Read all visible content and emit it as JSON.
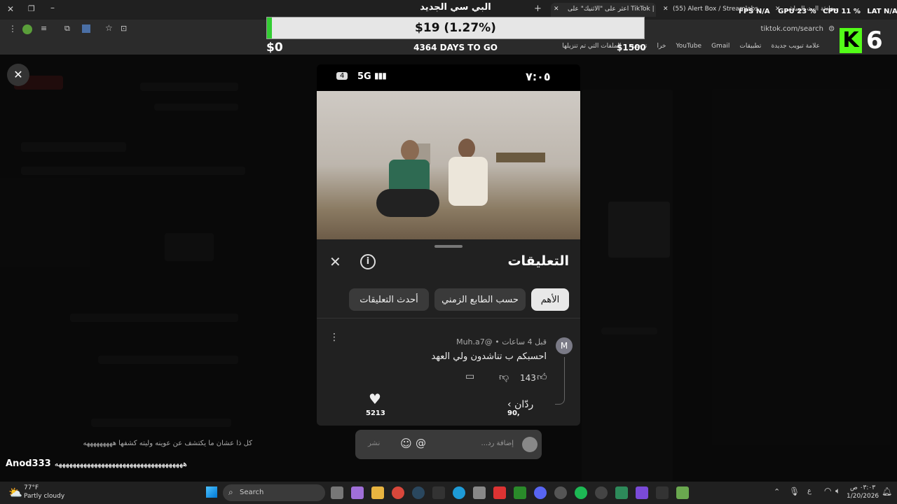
{
  "browser": {
    "tabs": [
      {
        "label": "اعثر على \"الاثنيك\" على TikTok | يـ"
      },
      {
        "label": "(55) Alert Box / Streamlabs"
      },
      {
        "label": "محادثة البث المباشر"
      }
    ],
    "stream_title": "البي سي الجديد",
    "url": "tiktok.com/search",
    "bookmarks": [
      "علامة تبويب جديدة",
      "تطبيقات",
      "Gmail",
      "YouTube",
      "خرا",
      "ترجمة",
      "الملفات التي تم تنزيلها"
    ]
  },
  "stream_overlay": {
    "goal_text": "$19 (1.27%)",
    "goal_progress_fraction": 0.0127,
    "goal_min": "$0",
    "goal_max": "$1500",
    "countdown": "4364 DAYS TO GO",
    "fps_label": "FPS",
    "fps_value": "N/A",
    "gpu_label": "GPU",
    "gpu_value": "23 %",
    "cpu_label": "CPU",
    "cpu_value": "11 %",
    "lat_label": "LAT",
    "lat_value": "N/A",
    "badge_number": "6",
    "chat_user": "Anod333",
    "chat_message": "ههههههههههههههههههههههههههههههههههههه",
    "chat_line_above": "كل ذا عشان ما يكتشف عن عوينه وليته كشفها هههههههههه"
  },
  "phone": {
    "carrier_badge": "4",
    "network": "5G",
    "time": "٧:٠٥"
  },
  "comments_panel": {
    "title": "التعليقات",
    "tabs": [
      {
        "label": "الأهم",
        "active": true
      },
      {
        "label": "حسب الطابع الزمني",
        "active": false
      },
      {
        "label": "أحدث التعليقات",
        "active": false
      }
    ],
    "comment": {
      "avatar_letter": "M",
      "author": "@Muh.a7",
      "separator": "•",
      "time": "قبل 4 ساعات",
      "text": "احسبكم ب تناشدون ولي العهد",
      "likes": "143",
      "replies_label": "ردّان",
      "reply_count_badge": "90,"
    },
    "video_likes": "5213"
  },
  "composer": {
    "placeholder": "إضافة رد...",
    "post_label": "نشر"
  },
  "taskbar": {
    "weather_temp": "77°F",
    "weather_desc": "Partly cloudy",
    "search_label": "Search",
    "lang": "ع",
    "time": "٠٣:٠٣ ص",
    "date": "1/20/2026"
  }
}
